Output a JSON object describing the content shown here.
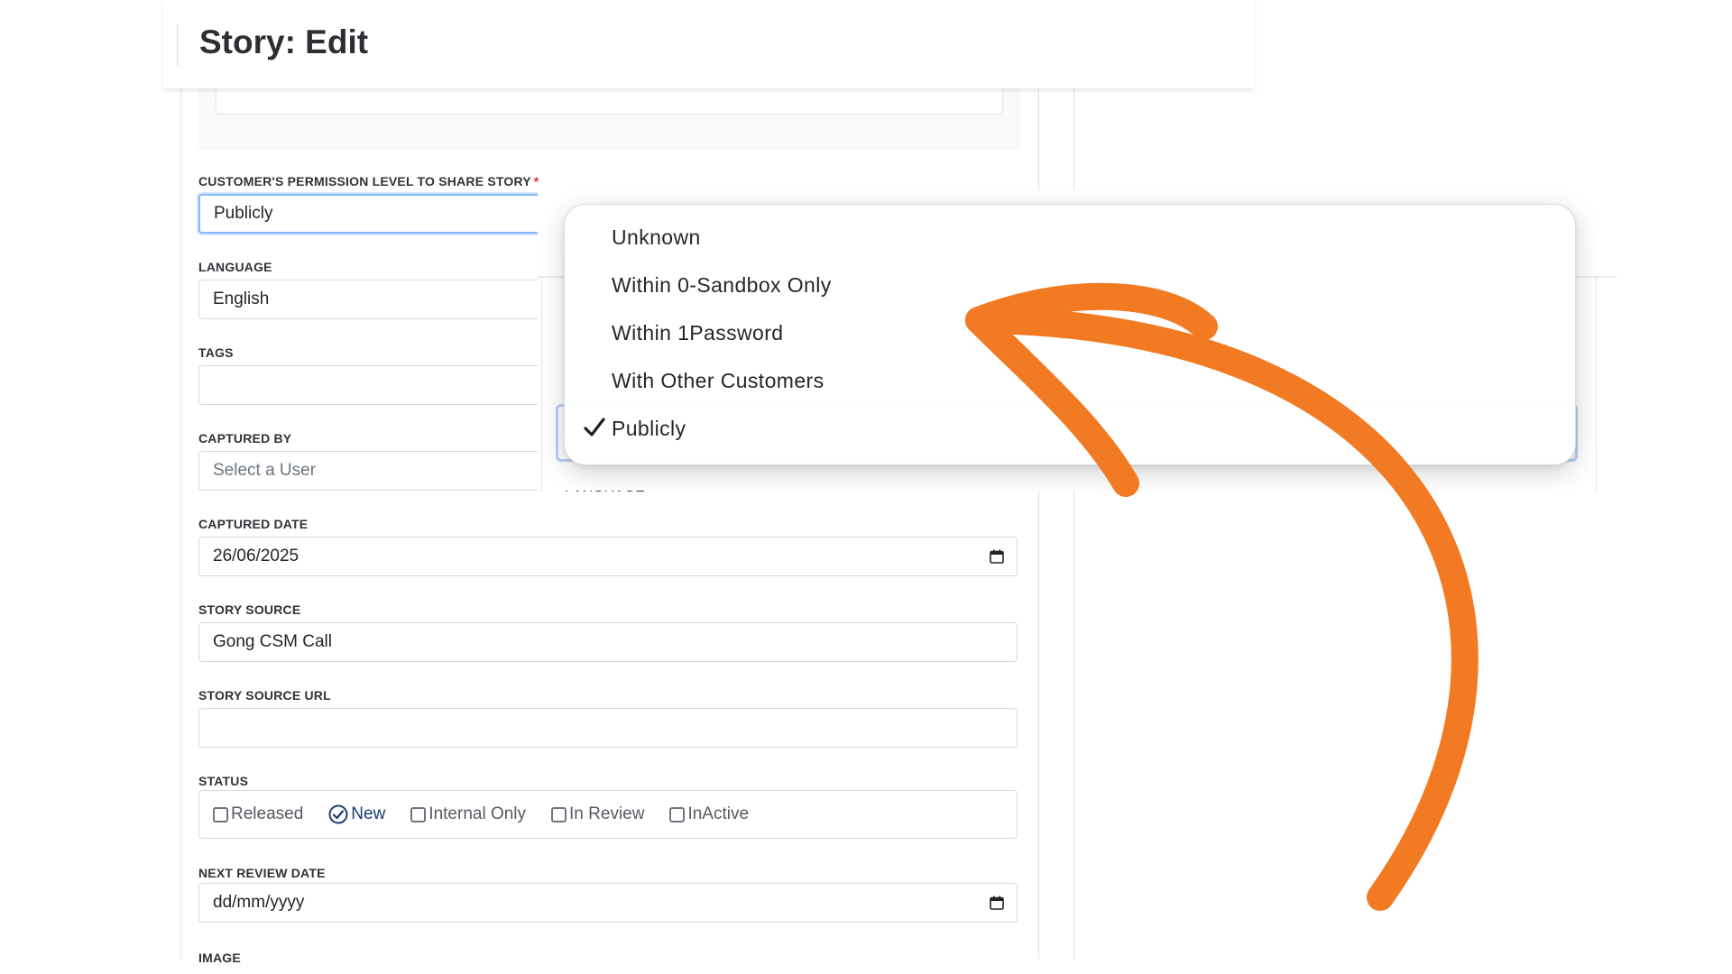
{
  "header": {
    "title": "Story: Edit"
  },
  "form": {
    "permission": {
      "label": "CUSTOMER'S PERMISSION LEVEL TO SHARE STORY",
      "required_mark": "*",
      "value": "Publicly"
    },
    "language": {
      "label": "LANGUAGE",
      "value": "English"
    },
    "tags": {
      "label": "TAGS",
      "value": ""
    },
    "captured_by": {
      "label": "CAPTURED BY",
      "placeholder": "Select a User"
    },
    "captured_date": {
      "label": "CAPTURED DATE",
      "value": "26/06/2025"
    },
    "story_source": {
      "label": "STORY SOURCE",
      "value": "Gong CSM Call"
    },
    "story_source_url": {
      "label": "STORY SOURCE URL",
      "value": ""
    },
    "status": {
      "label": "STATUS",
      "options": [
        {
          "label": "Released",
          "checked": false
        },
        {
          "label": "New",
          "checked": true
        },
        {
          "label": "Internal Only",
          "checked": false
        },
        {
          "label": "In Review",
          "checked": false
        },
        {
          "label": "InActive",
          "checked": false
        }
      ]
    },
    "next_review_date": {
      "label": "NEXT REVIEW DATE",
      "value": "dd/mm/yyyy"
    },
    "image": {
      "label": "IMAGE"
    }
  },
  "dropdown": {
    "options": [
      "Unknown",
      "Within 0-Sandbox Only",
      "Within 1Password",
      "With Other Customers",
      "Publicly"
    ],
    "selected": "Publicly"
  },
  "annotation": {
    "arrow_color": "#F27A22"
  },
  "colors": {
    "focus_border": "#86b7fe",
    "active_status": "#1a3d6d",
    "required": "#d93025"
  }
}
